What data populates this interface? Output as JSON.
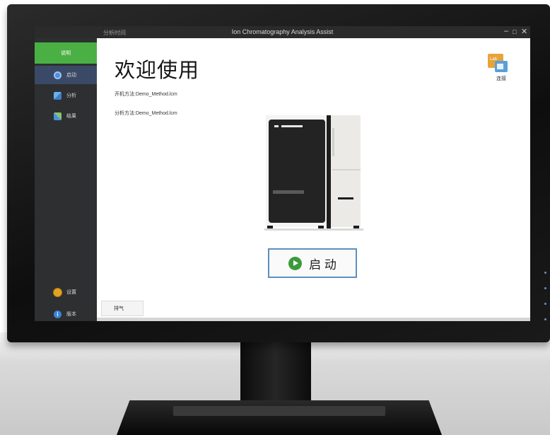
{
  "window": {
    "module_label": "分析时间",
    "title": "Ion Chromatography Analysis Assist",
    "controls": [
      "–",
      "□",
      "✕"
    ]
  },
  "sidebar": {
    "status_label": "说明",
    "items": [
      {
        "label": "启动",
        "icon": "power-icon"
      },
      {
        "label": "分析",
        "icon": "analysis-icon"
      },
      {
        "label": "结果",
        "icon": "results-icon"
      }
    ],
    "bottom_items": [
      {
        "label": "设置",
        "icon": "gear-icon"
      },
      {
        "label": "版本",
        "icon": "info-icon"
      }
    ]
  },
  "main": {
    "welcome": "欢迎使用",
    "startup_method": "开机方法:Demo_Method.lcm",
    "analysis_method": "分析方法:Demo_Method.lcm",
    "start_button": "启 动",
    "exhaust_button": "排气"
  },
  "logo": {
    "badge_text": "Lab",
    "label": "连接"
  },
  "colors": {
    "accent_green": "#4bb043",
    "sidebar_bg": "#2e2f31",
    "start_border": "#5b8fbf"
  }
}
